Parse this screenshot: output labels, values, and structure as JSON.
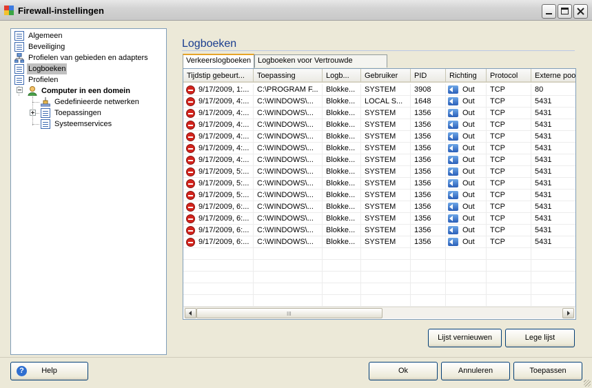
{
  "window": {
    "title": "Firewall-instellingen"
  },
  "tree": {
    "items": [
      {
        "label": "Algemeen",
        "icon": "document-icon"
      },
      {
        "label": "Beveiliging",
        "icon": "document-icon"
      },
      {
        "label": "Profielen van gebieden en adapters",
        "icon": "network-icon"
      },
      {
        "label": "Logboeken",
        "icon": "document-icon",
        "selected": true
      },
      {
        "label": "Profielen",
        "icon": "document-icon"
      },
      {
        "label": "Computer in een domein",
        "icon": "user-icon",
        "bold": true
      },
      {
        "label": "Gedefinieerde netwerken",
        "icon": "network-icon"
      },
      {
        "label": "Toepassingen",
        "icon": "document-icon"
      },
      {
        "label": "Systeemservices",
        "icon": "document-icon"
      }
    ]
  },
  "main": {
    "heading": "Logboeken",
    "tabs": [
      {
        "label": "Verkeerslogboeken",
        "active": true
      },
      {
        "label": "Logboeken voor Vertrouwde database",
        "active": false
      }
    ],
    "columns": [
      "Tijdstip gebeurt...",
      "Toepassing",
      "Logb...",
      "Gebruiker",
      "PID",
      "Richting",
      "Protocol",
      "Externe poo"
    ],
    "rows": [
      [
        "9/17/2009, 1:...",
        "C:\\PROGRAM F...",
        "Blokke...",
        "SYSTEM",
        "3908",
        "Out",
        "TCP",
        "80"
      ],
      [
        "9/17/2009, 4:...",
        "C:\\WINDOWS\\...",
        "Blokke...",
        "LOCAL S...",
        "1648",
        "Out",
        "TCP",
        "5431"
      ],
      [
        "9/17/2009, 4:...",
        "C:\\WINDOWS\\...",
        "Blokke...",
        "SYSTEM",
        "1356",
        "Out",
        "TCP",
        "5431"
      ],
      [
        "9/17/2009, 4:...",
        "C:\\WINDOWS\\...",
        "Blokke...",
        "SYSTEM",
        "1356",
        "Out",
        "TCP",
        "5431"
      ],
      [
        "9/17/2009, 4:...",
        "C:\\WINDOWS\\...",
        "Blokke...",
        "SYSTEM",
        "1356",
        "Out",
        "TCP",
        "5431"
      ],
      [
        "9/17/2009, 4:...",
        "C:\\WINDOWS\\...",
        "Blokke...",
        "SYSTEM",
        "1356",
        "Out",
        "TCP",
        "5431"
      ],
      [
        "9/17/2009, 4:...",
        "C:\\WINDOWS\\...",
        "Blokke...",
        "SYSTEM",
        "1356",
        "Out",
        "TCP",
        "5431"
      ],
      [
        "9/17/2009, 5:...",
        "C:\\WINDOWS\\...",
        "Blokke...",
        "SYSTEM",
        "1356",
        "Out",
        "TCP",
        "5431"
      ],
      [
        "9/17/2009, 5:...",
        "C:\\WINDOWS\\...",
        "Blokke...",
        "SYSTEM",
        "1356",
        "Out",
        "TCP",
        "5431"
      ],
      [
        "9/17/2009, 5:...",
        "C:\\WINDOWS\\...",
        "Blokke...",
        "SYSTEM",
        "1356",
        "Out",
        "TCP",
        "5431"
      ],
      [
        "9/17/2009, 6:...",
        "C:\\WINDOWS\\...",
        "Blokke...",
        "SYSTEM",
        "1356",
        "Out",
        "TCP",
        "5431"
      ],
      [
        "9/17/2009, 6:...",
        "C:\\WINDOWS\\...",
        "Blokke...",
        "SYSTEM",
        "1356",
        "Out",
        "TCP",
        "5431"
      ],
      [
        "9/17/2009, 6:...",
        "C:\\WINDOWS\\...",
        "Blokke...",
        "SYSTEM",
        "1356",
        "Out",
        "TCP",
        "5431"
      ],
      [
        "9/17/2009, 6:...",
        "C:\\WINDOWS\\...",
        "Blokke...",
        "SYSTEM",
        "1356",
        "Out",
        "TCP",
        "5431"
      ]
    ],
    "scroll_grip": "III",
    "refresh_label": "Lijst vernieuwen",
    "clear_label": "Lege lijst"
  },
  "footer": {
    "help_label": "Help",
    "ok_label": "Ok",
    "cancel_label": "Annuleren",
    "apply_label": "Toepassen"
  },
  "colors": {
    "heading": "#1a3d8f",
    "block_icon": "#d3241d",
    "tab_accent": "#e6a429"
  }
}
